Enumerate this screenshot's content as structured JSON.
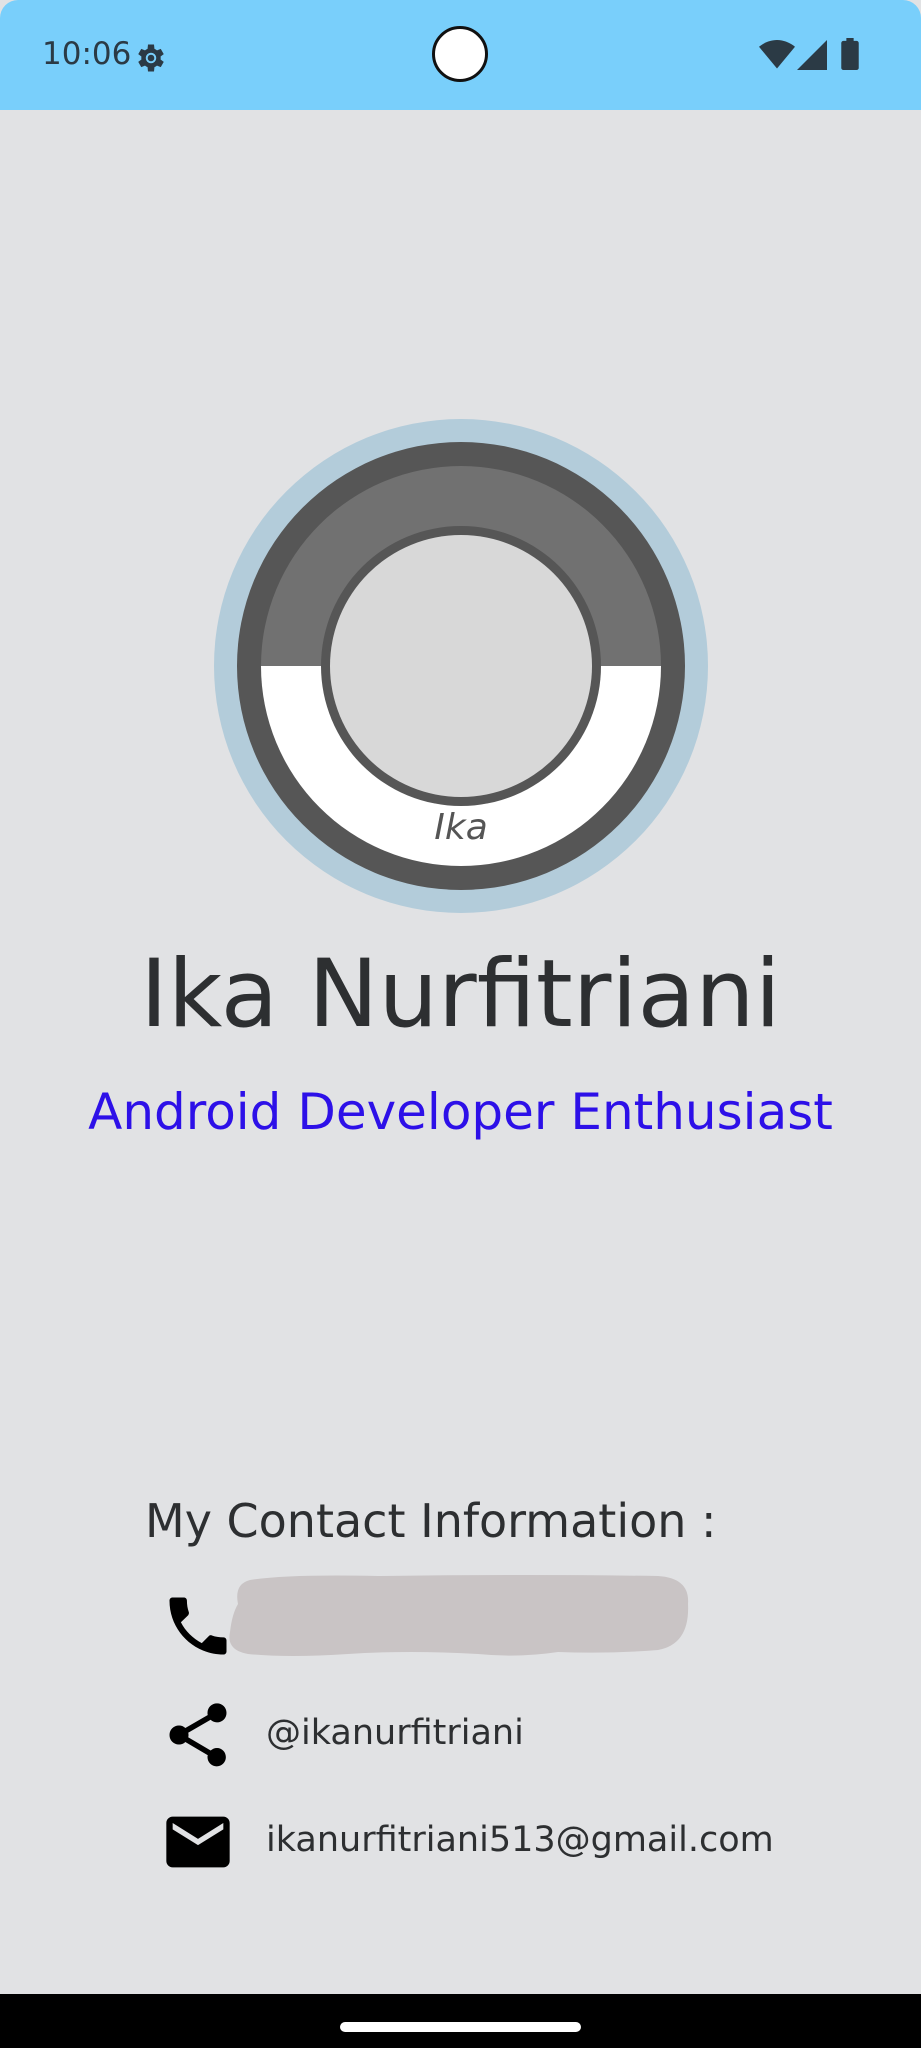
{
  "status_bar": {
    "time": "10:06",
    "icons": [
      "gear-icon",
      "wifi-icon",
      "signal-icon",
      "battery-icon"
    ],
    "background": "#79cffb"
  },
  "profile": {
    "logo_text": "Ika",
    "name": "Ika Nurfitriani",
    "headline": "Android Developer Enthusiast",
    "headline_color": "#2d10e8"
  },
  "contact": {
    "title": "My Contact Information :",
    "phone": {
      "icon": "phone-icon",
      "value": ""
    },
    "social": {
      "icon": "share-icon",
      "value": "@ikanurfitriani"
    },
    "email": {
      "icon": "mail-icon",
      "value": "ikanurfitriani513@gmail.com"
    }
  },
  "colors": {
    "background": "#e1e2e4",
    "text": "#2d2f31"
  }
}
